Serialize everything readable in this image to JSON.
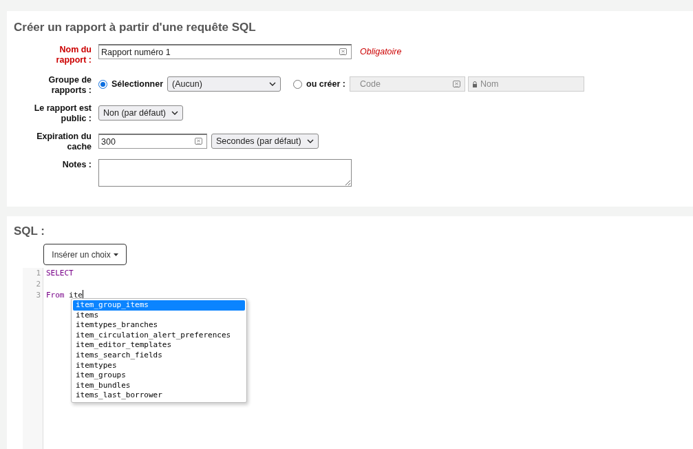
{
  "page_title": "Créer un rapport à partir d'une requête SQL",
  "report_name": {
    "label": "Nom du rapport :",
    "required": true,
    "value": "Rapport numéro 1",
    "note": "Obligatoire"
  },
  "report_group": {
    "label": "Groupe de rapports :",
    "options": [
      {
        "kind": "select",
        "label": "Sélectionner",
        "selected": true,
        "value": "(Aucun)"
      },
      {
        "kind": "create",
        "label": "ou créer :",
        "selected": false,
        "code_placeholder": "Code",
        "name_placeholder": "Nom",
        "disabled": true
      }
    ]
  },
  "public": {
    "label": "Le rapport est public :",
    "value": "Non (par défaut)"
  },
  "cache": {
    "label": "Expiration du cache",
    "value": "300",
    "unit": "Secondes (par défaut)"
  },
  "notes": {
    "label": "Notes :"
  },
  "sql": {
    "title": "SQL :",
    "insert_button": "Insérer un choix",
    "lines": [
      {
        "number": "1",
        "tokens": [
          {
            "text": "SELECT",
            "kind": "keyword"
          }
        ]
      },
      {
        "number": "2"
      },
      {
        "number": "3",
        "tokens": [
          {
            "text": "From",
            "kind": "keyword"
          },
          {
            "text": " ite",
            "kind": "plain"
          }
        ],
        "cursor": true
      }
    ],
    "suggestions": [
      {
        "text": "item_group_items",
        "selected": true
      },
      {
        "text": "items",
        "selected": false
      },
      {
        "text": "itemtypes_branches",
        "selected": false
      },
      {
        "text": "item_circulation_alert_preferences",
        "selected": false
      },
      {
        "text": "item_editor_templates",
        "selected": false
      },
      {
        "text": "items_search_fields",
        "selected": false
      },
      {
        "text": "itemtypes",
        "selected": false
      },
      {
        "text": "item_groups",
        "selected": false
      },
      {
        "text": "item_bundles",
        "selected": false
      },
      {
        "text": "items_last_borrower",
        "selected": false
      }
    ]
  }
}
